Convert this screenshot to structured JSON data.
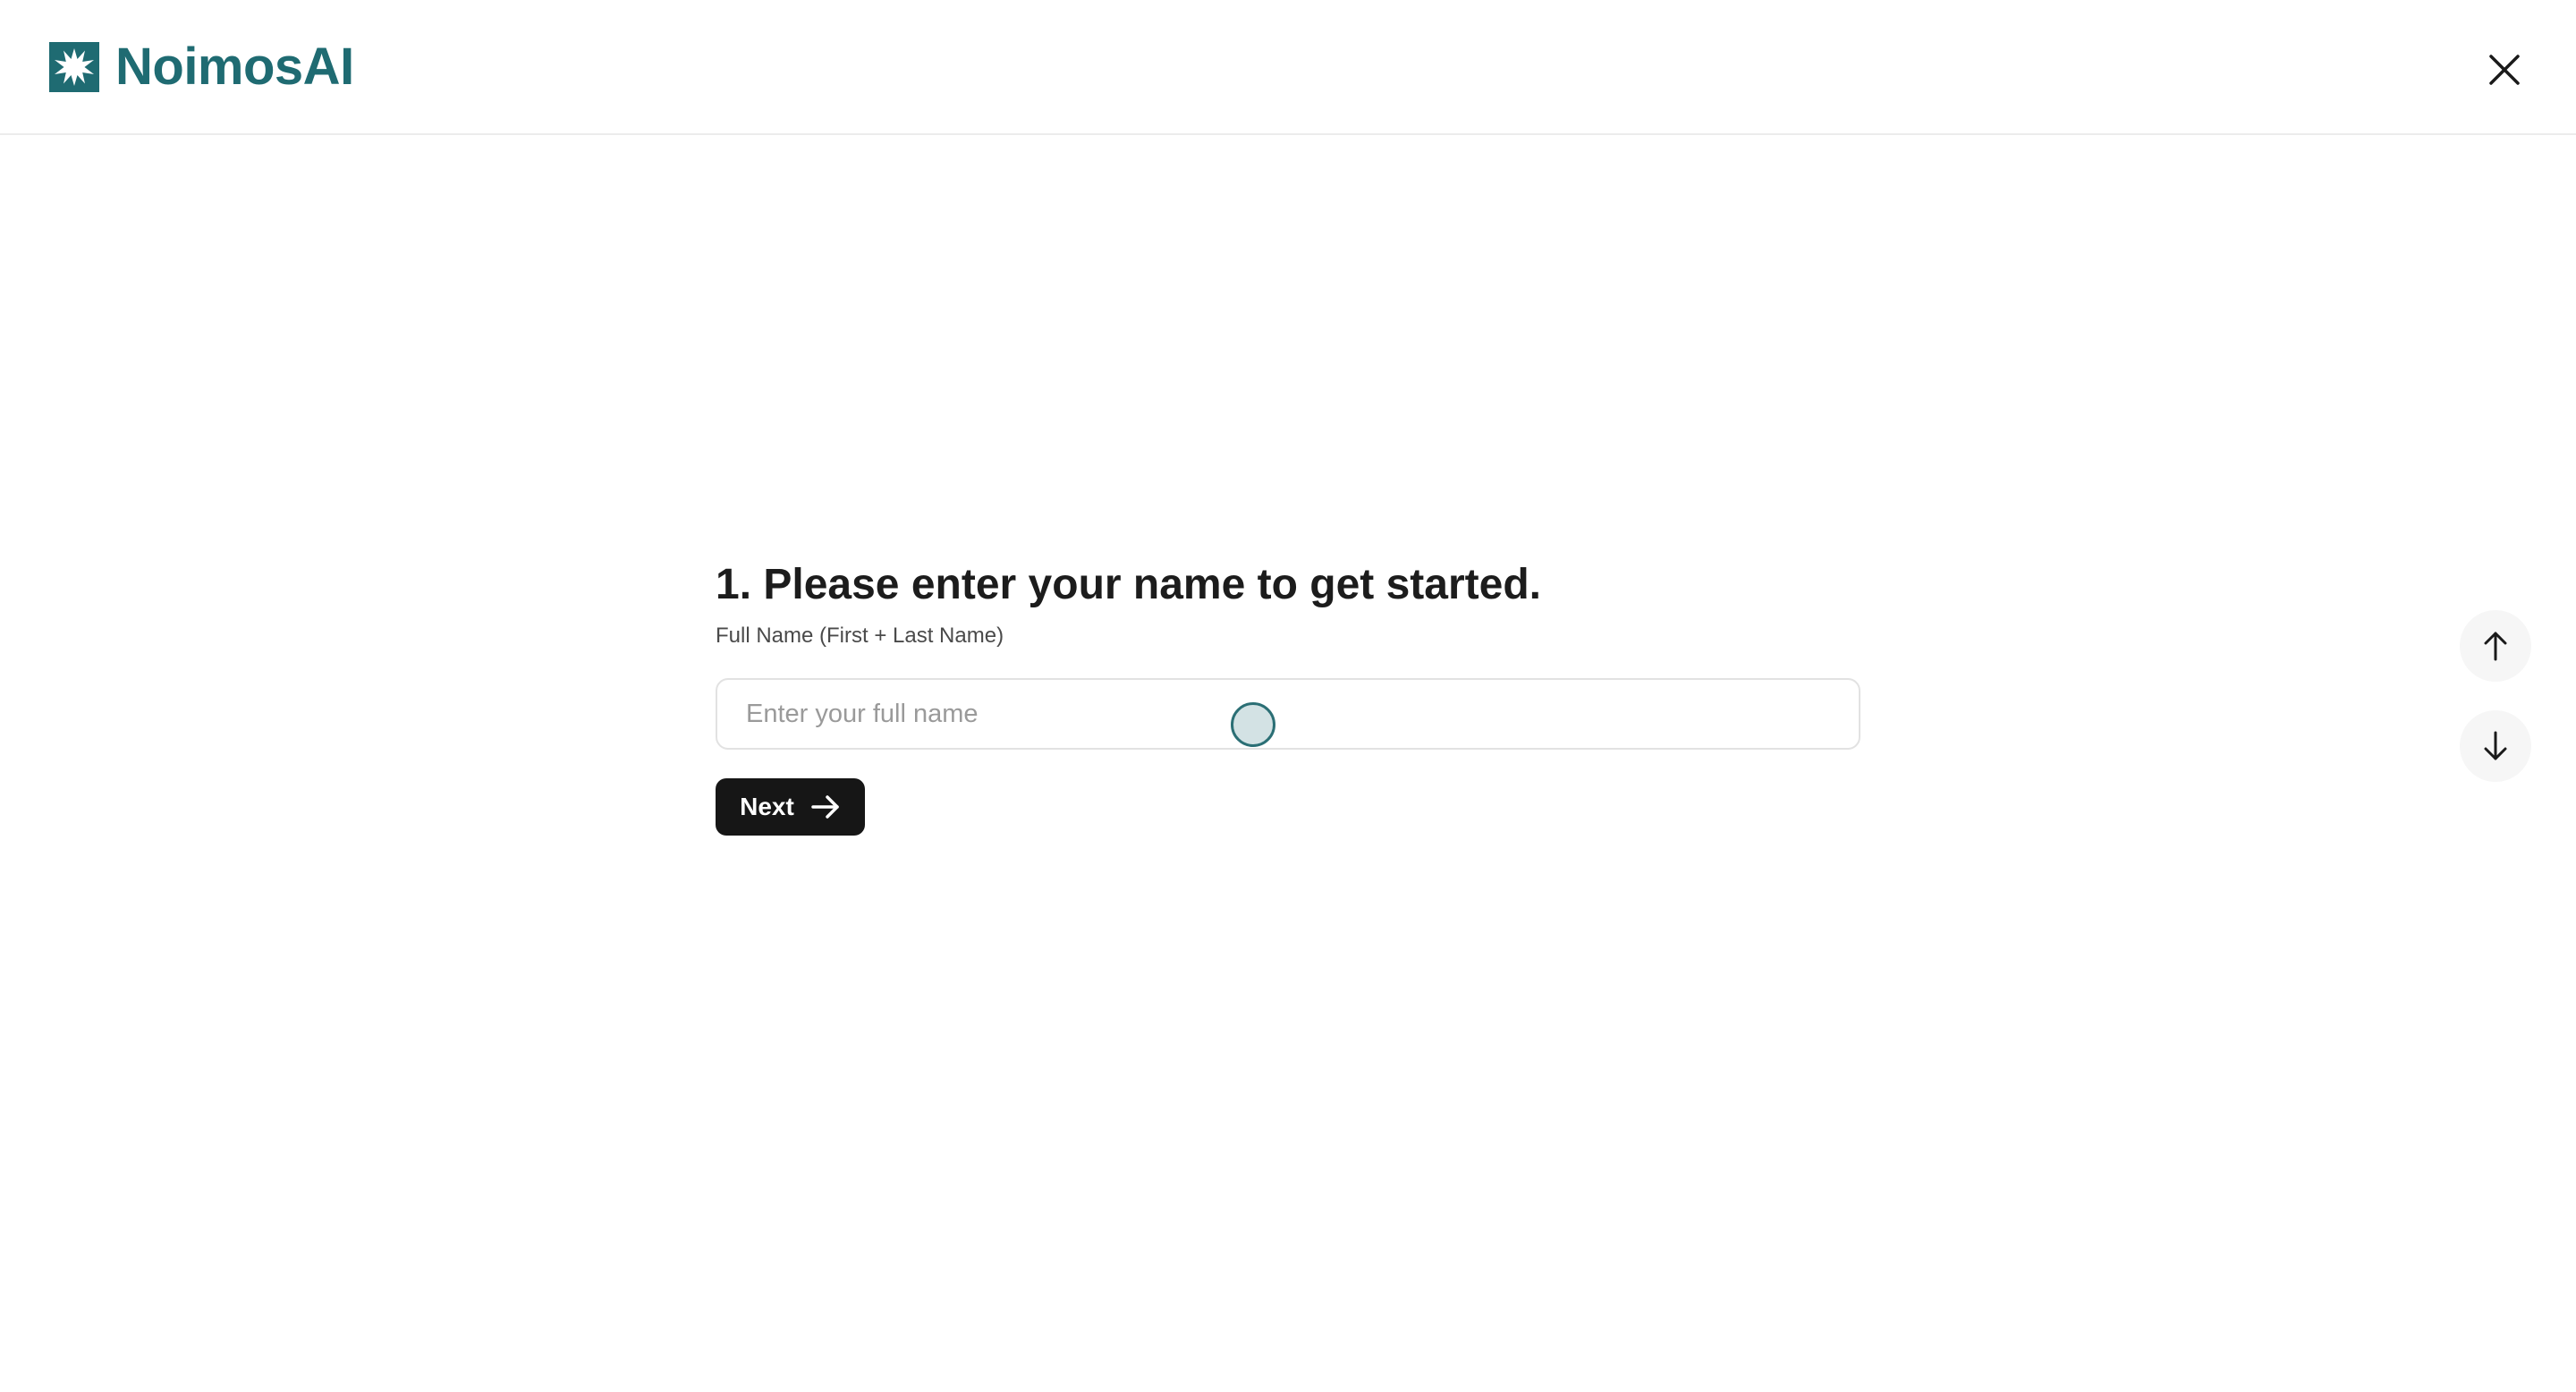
{
  "header": {
    "brand_name": "NoimosAI",
    "brand_color": "#1f6b72",
    "logo_icon": "starburst-logo-icon",
    "close_icon": "close-icon"
  },
  "form": {
    "question": "1. Please enter your name to get started.",
    "field_label": "Full Name (First + Last Name)",
    "input_value": "",
    "input_placeholder": "Enter your full name",
    "next_label": "Next",
    "next_icon": "arrow-right-icon"
  },
  "navigation": {
    "up_icon": "arrow-up-icon",
    "down_icon": "arrow-down-icon"
  }
}
